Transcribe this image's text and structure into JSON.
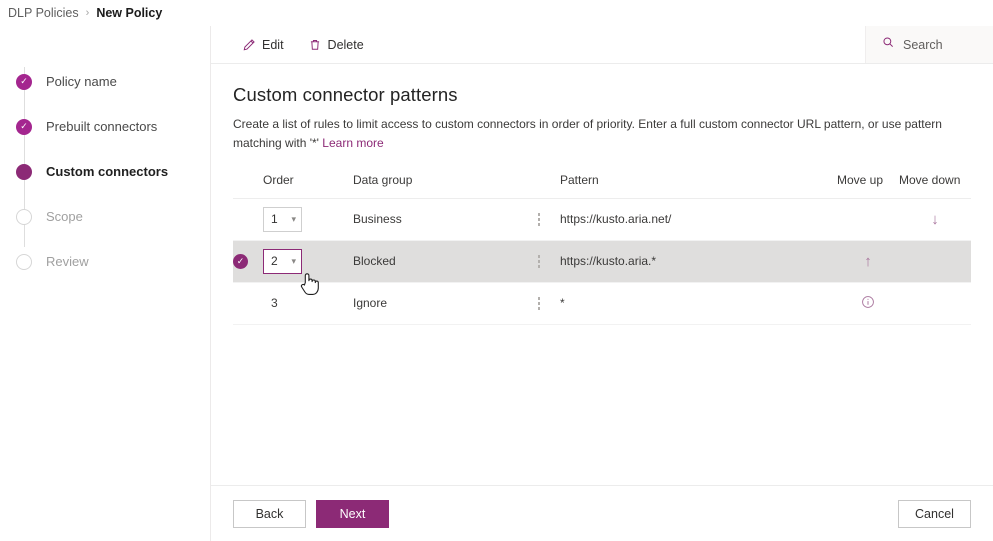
{
  "breadcrumb": {
    "parent": "DLP Policies",
    "separator": "›",
    "current": "New Policy"
  },
  "wizard": {
    "steps": [
      {
        "label": "Policy name",
        "state": "done",
        "icon": "check-circle-icon"
      },
      {
        "label": "Prebuilt connectors",
        "state": "done",
        "icon": "check-circle-icon"
      },
      {
        "label": "Custom connectors",
        "state": "current",
        "icon": "filled-circle-icon"
      },
      {
        "label": "Scope",
        "state": "pending",
        "icon": "empty-circle-icon"
      },
      {
        "label": "Review",
        "state": "pending",
        "icon": "empty-circle-icon"
      }
    ]
  },
  "commandbar": {
    "edit_label": "Edit",
    "delete_label": "Delete"
  },
  "search": {
    "placeholder": "Search",
    "value": ""
  },
  "main": {
    "title": "Custom connector patterns",
    "description": "Create a list of rules to limit access to custom connectors in order of priority. Enter a full custom connector URL pattern, or use pattern matching with '*'",
    "learn_more": "Learn more"
  },
  "table": {
    "headers": {
      "order": "Order",
      "data_group": "Data group",
      "pattern": "Pattern",
      "move_up": "Move up",
      "move_down": "Move down"
    },
    "rows": [
      {
        "selected": false,
        "order": "1",
        "order_is_dropdown": true,
        "order_focused": false,
        "data_group": "Business",
        "pattern": "https://kusto.aria.net/",
        "move_up": "",
        "move_down": "↓",
        "trailing_icon": ""
      },
      {
        "selected": true,
        "order": "2",
        "order_is_dropdown": true,
        "order_focused": true,
        "data_group": "Blocked",
        "pattern": "https://kusto.aria.*",
        "move_up": "↑",
        "move_down": "",
        "trailing_icon": ""
      },
      {
        "selected": false,
        "order": "3",
        "order_is_dropdown": false,
        "order_focused": false,
        "data_group": "Ignore",
        "pattern": "*",
        "move_up": "",
        "move_down": "",
        "trailing_icon": "info-icon"
      }
    ]
  },
  "footer": {
    "back_label": "Back",
    "next_label": "Next",
    "cancel_label": "Cancel"
  },
  "colors": {
    "accent": "#8c2a76",
    "accent_light": "#a4268f",
    "selected_row": "#dfdedd",
    "arrow": "#a8749c",
    "search_bg": "#faf9f8"
  }
}
